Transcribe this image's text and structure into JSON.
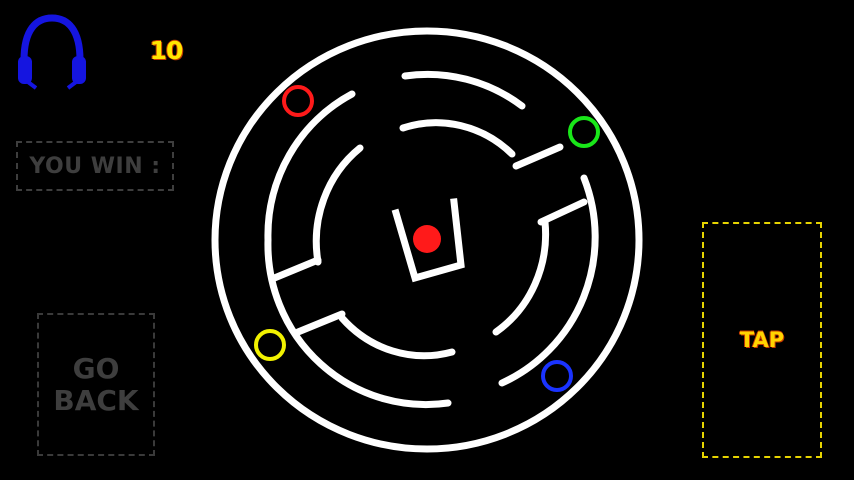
{
  "hud": {
    "score": "10",
    "win_label": "YOU WIN :",
    "go_back_label": "GO\nBACK",
    "tap_label": "TAP",
    "sound_icon": "headphones-icon"
  },
  "colors": {
    "background": "#000000",
    "maze_walls": "#ffffff",
    "ball": "#ff1a1a",
    "score_text": "#ffe600",
    "tap_border": "#e6d400",
    "inactive_text": "#3e3e3e",
    "headphones": "#1515e0",
    "target_red": "#ff1a1a",
    "target_green": "#19e619",
    "target_yellow": "#f2f200",
    "target_blue": "#1a33ff"
  },
  "targets": [
    "red-ring",
    "green-ring",
    "yellow-ring",
    "blue-ring"
  ]
}
